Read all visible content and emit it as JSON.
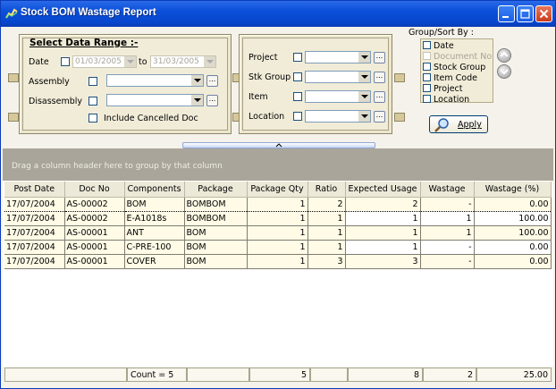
{
  "window": {
    "title": "Stock BOM Wastage Report"
  },
  "filters": {
    "header": "Select Data Range :-",
    "date_label": "Date",
    "date_from": "01/03/2005",
    "to_label": "to",
    "date_to": "31/03/2005",
    "assembly_label": "Assembly",
    "disassembly_label": "Disassembly",
    "include_cancelled_label": "Include Cancelled Doc",
    "project_label": "Project",
    "stk_group_label": "Stk Group",
    "item_label": "Item",
    "location_label": "Location",
    "ellipsis": "..."
  },
  "group_sort": {
    "label": "Group/Sort By :",
    "options": [
      "Date",
      "Document No",
      "Stock Group",
      "Item Code",
      "Project",
      "Location"
    ],
    "disabled": [
      false,
      true,
      false,
      false,
      false,
      false
    ]
  },
  "apply_label": "Apply",
  "grid": {
    "group_hint": "Drag a column header here to group by that column",
    "columns": [
      "Post Date",
      "Doc No",
      "Components",
      "Package",
      "Package Qty",
      "Ratio",
      "Expected Usage",
      "Wastage",
      "Wastage (%)"
    ],
    "rows": [
      [
        "17/07/2004",
        "AS-00002",
        "BOM",
        "BOMBOM",
        "1",
        "2",
        "2",
        "-",
        "0.00"
      ],
      [
        "17/07/2004",
        "AS-00002",
        "E-A1018s",
        "BOMBOM",
        "1",
        "1",
        "1",
        "1",
        "100.00"
      ],
      [
        "17/07/2004",
        "AS-00001",
        "ANT",
        "BOM",
        "1",
        "1",
        "1",
        "1",
        "100.00"
      ],
      [
        "17/07/2004",
        "AS-00001",
        "C-PRE-100",
        "BOM",
        "1",
        "1",
        "1",
        "-",
        "0.00"
      ],
      [
        "17/07/2004",
        "AS-00001",
        "COVER",
        "BOM",
        "1",
        "3",
        "3",
        "-",
        "0.00"
      ]
    ],
    "footer": {
      "count": "Count = 5",
      "package_qty": "5",
      "expected_usage": "8",
      "wastage": "2",
      "wastage_pct": "25.00"
    }
  },
  "colors": {
    "titlebar": "#0a4fd9",
    "groupbar": "#a9a59a",
    "row_bg": "#fffbe6"
  }
}
